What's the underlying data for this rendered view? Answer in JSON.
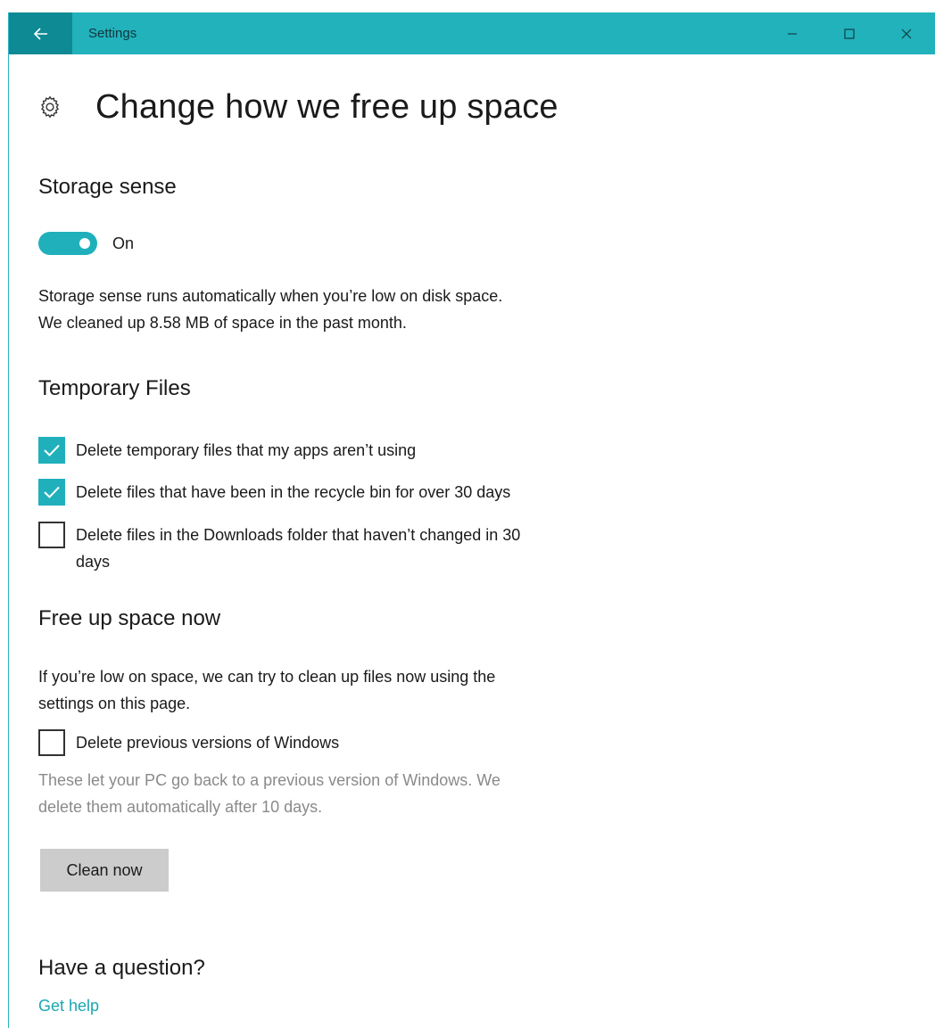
{
  "window": {
    "title": "Settings",
    "accent_color": "#21b2bc",
    "back_icon": "back-arrow-icon",
    "controls": [
      "minimize-icon",
      "maximize-icon",
      "close-icon"
    ]
  },
  "page": {
    "title": "Change how we free up space",
    "icon": "gear-icon"
  },
  "storage_sense": {
    "heading": "Storage sense",
    "toggle_state": "On",
    "toggle_on": true,
    "description_line1": "Storage sense runs automatically when you’re low on disk space.",
    "description_line2": "We cleaned up 8.58 MB of space in the past month."
  },
  "temporary_files": {
    "heading": "Temporary Files",
    "options": [
      {
        "label": "Delete temporary files that my apps aren’t using",
        "checked": true
      },
      {
        "label": "Delete files that have been in the recycle bin for over 30 days",
        "checked": true
      },
      {
        "label_line1": "Delete files in the Downloads folder that haven’t changed in 30",
        "label_line2": "days",
        "checked": false
      }
    ]
  },
  "free_up": {
    "heading": "Free up space now",
    "description_line1": "If you’re low on space, we can try to clean up files now using the",
    "description_line2": "settings on this page.",
    "option": {
      "label": "Delete previous versions of Windows",
      "checked": false
    },
    "note_line1": "These let your PC go back to a previous version of Windows. We",
    "note_line2": "delete them automatically after 10 days.",
    "button_label": "Clean now"
  },
  "help": {
    "heading": "Have a question?",
    "link_label": "Get help"
  }
}
